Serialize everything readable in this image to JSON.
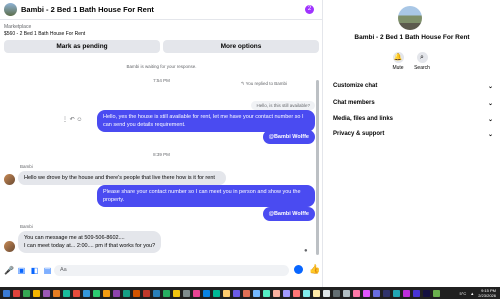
{
  "header": {
    "title": "Bambi - 2 Bed 1 Bath House For Rent",
    "menu_glyph": "2"
  },
  "listing": {
    "label": "Marketplace",
    "price_title": "$560 - 2 Bed 1 Bath House For Rent"
  },
  "actions": {
    "mark_pending": "Mark as pending",
    "more_options": "More options"
  },
  "thread": {
    "waiting": "Bambi is waiting for your response.",
    "time1": "7:54 PM",
    "you_replied": "You replied to Bambi",
    "quoted": "Hello, is this still available?",
    "out1": "Hello, yes the house is still available for rent, let me have your contact number so I can send you details requirement.",
    "mention1": "@Bambi Wolffe",
    "time2": "8:39 PM",
    "sender1": "Bambi",
    "in1": "Hello we drove by the house and there's people that live there how is it for rent",
    "out2": "Please share your contact number so I can meet you in person and show you the property.",
    "mention2": "@Bambi Wolffe",
    "sender2": "Bambi",
    "in2_line1": "You can message me at 509-506-8602....",
    "in2_line2": "I can meet today at... 2:00.... pm if that works for you?"
  },
  "composer": {
    "placeholder": "Aa"
  },
  "info": {
    "name": "Bambi - 2 Bed 1 Bath House For Rent",
    "mute": "Mute",
    "search": "Search",
    "rows": [
      "Customize chat",
      "Chat members",
      "Media, files and links",
      "Privacy & support"
    ]
  },
  "taskbar": {
    "temp": "5°C",
    "time": "9:15 PM",
    "date": "2/23/2026",
    "icon_colors": [
      "#3a7bd5",
      "#e0433b",
      "#35a853",
      "#f4b400",
      "#9b59b6",
      "#e67e22",
      "#1abc9c",
      "#e74c3c",
      "#3498db",
      "#2ecc71",
      "#f39c12",
      "#8e44ad",
      "#16a085",
      "#d35400",
      "#c0392b",
      "#2980b9",
      "#27ae60",
      "#f1c40f",
      "#7f8c8d",
      "#e84393",
      "#0984e3",
      "#00b894",
      "#fdcb6e",
      "#6c5ce7",
      "#e17055",
      "#74b9ff",
      "#55efc4",
      "#fab1a0",
      "#a29bfe",
      "#ff7675",
      "#81ecec",
      "#ffeaa7",
      "#dfe6e9",
      "#636e72",
      "#b2bec3",
      "#fd79a8",
      "#e056fd",
      "#686de0",
      "#30336b",
      "#22a6b3",
      "#be2edd",
      "#4834d4",
      "#130f40",
      "#6ab04c",
      "#eb4d4b",
      "#f9ca24",
      "#badc58",
      "#c7ecee",
      "#95afc0",
      "#535c68"
    ]
  },
  "colors": {
    "accent": "#4a4bf1",
    "link": "#0866ff",
    "muted": "#65676b"
  }
}
